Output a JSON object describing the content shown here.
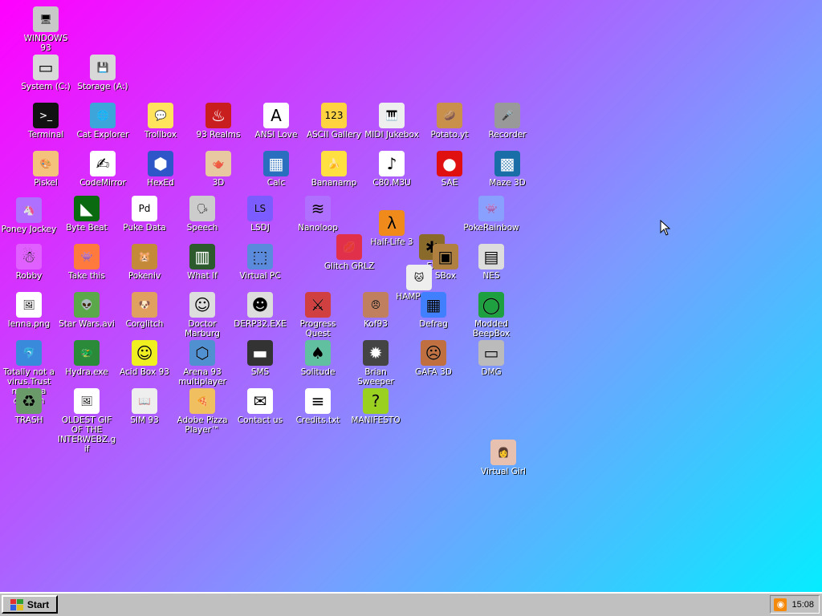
{
  "desktop": {
    "icons": [
      {
        "id": "windows93",
        "label": "WINDOWS 93",
        "icon": "computer-icon",
        "glyph": "🖥",
        "bg": "#c8c8c8"
      },
      {
        "id": "system-c",
        "label": "System (C:)",
        "icon": "hard-drive-icon",
        "glyph": "▭",
        "bg": "#d8d8d8"
      },
      {
        "id": "storage-a",
        "label": "Storage (A:)",
        "icon": "floppy-drive-icon",
        "glyph": "💾",
        "bg": "#d8d8d8"
      },
      {
        "id": "terminal",
        "label": "Terminal",
        "icon": "terminal-icon",
        "glyph": ">_",
        "bg": "#111111"
      },
      {
        "id": "cat-explorer",
        "label": "Cat Explorer",
        "icon": "cat-globe-icon",
        "glyph": "🌐",
        "bg": "#3da5d9"
      },
      {
        "id": "trollbox",
        "label": "Trollbox",
        "icon": "chat-bubble-icon",
        "glyph": "💬",
        "bg": "#ffe35c"
      },
      {
        "id": "93-realms",
        "label": "93 Realms",
        "icon": "realms-icon",
        "glyph": "♨",
        "bg": "#c81e1e"
      },
      {
        "id": "ansi-love",
        "label": "ANSI Love",
        "icon": "ansi-letter-icon",
        "glyph": "A",
        "bg": "#ffffff"
      },
      {
        "id": "ascii-gallery",
        "label": "ASCII Gallery",
        "icon": "ascii-numbers-icon",
        "glyph": "123",
        "bg": "#ffd23f"
      },
      {
        "id": "midi-jukebox",
        "label": "MIDI Jukebox",
        "icon": "piano-icon",
        "glyph": "🎹",
        "bg": "#eeeeee"
      },
      {
        "id": "potato-yt",
        "label": "Potato.yt",
        "icon": "potato-icon",
        "glyph": "🥔",
        "bg": "#c8904a"
      },
      {
        "id": "recorder",
        "label": "Recorder",
        "icon": "microphone-icon",
        "glyph": "🎤",
        "bg": "#999999"
      },
      {
        "id": "piskel",
        "label": "Piskel",
        "icon": "palette-icon",
        "glyph": "🎨",
        "bg": "#f4c27a"
      },
      {
        "id": "codemirror",
        "label": "CodeMirror",
        "icon": "codemirror-icon",
        "glyph": "✍",
        "bg": "#ffffff"
      },
      {
        "id": "hexed",
        "label": "HexEd",
        "icon": "hex-cube-icon",
        "glyph": "⬢",
        "bg": "#2e56c8"
      },
      {
        "id": "3d",
        "label": "3D",
        "icon": "teapot-icon",
        "glyph": "🫖",
        "bg": "#e8c8a0"
      },
      {
        "id": "calc",
        "label": "Calc",
        "icon": "calculator-icon",
        "glyph": "▦",
        "bg": "#2a6fbf"
      },
      {
        "id": "bananamp",
        "label": "Bananamp",
        "icon": "banana-icon",
        "glyph": "🍌",
        "bg": "#ffe040"
      },
      {
        "id": "c80-m3u",
        "label": "C80.M3U",
        "icon": "playlist-file-icon",
        "glyph": "♪",
        "bg": "#ffffff"
      },
      {
        "id": "sae",
        "label": "SAE",
        "icon": "checkered-ball-icon",
        "glyph": "●",
        "bg": "#e01010"
      },
      {
        "id": "maze-3d",
        "label": "Maze 3D",
        "icon": "maze-icon",
        "glyph": "▩",
        "bg": "#1a6ea8"
      },
      {
        "id": "poney-jockey",
        "label": "Poney Jockey",
        "icon": "pony-icon",
        "glyph": "🦄",
        "bg": "#b070ff"
      },
      {
        "id": "byte-beat",
        "label": "Byte Beat",
        "icon": "bytebeat-icon",
        "glyph": "◣",
        "bg": "#0a6a10"
      },
      {
        "id": "puke-data",
        "label": "Puke Data",
        "icon": "pd-icon",
        "glyph": "Pd",
        "bg": "#ffffff"
      },
      {
        "id": "speech",
        "label": "Speech",
        "icon": "speech-face-icon",
        "glyph": "🗣",
        "bg": "#cccccc"
      },
      {
        "id": "lsdj",
        "label": "LSDJ",
        "icon": "lsdj-icon",
        "glyph": "LS",
        "bg": "#7a5cff"
      },
      {
        "id": "nanoloop",
        "label": "Nanoloop",
        "icon": "nanoloop-icon",
        "glyph": "≋",
        "bg": "#b070ff"
      },
      {
        "id": "half-life-3",
        "label": "Half-Life 3",
        "icon": "lambda-icon",
        "glyph": "λ",
        "bg": "#f08a1a"
      },
      {
        "id": "pokerainbow",
        "label": "PokeRainbow",
        "icon": "pokerainbow-icon",
        "glyph": "👾",
        "bg": "#8aa0ff"
      },
      {
        "id": "glitch-grlz",
        "label": "Glitch GRLZ",
        "icon": "lips-icon",
        "glyph": "💋",
        "bg": "#e0304a"
      },
      {
        "id": "robby",
        "label": "Robby",
        "icon": "stick-figure-icon",
        "glyph": "☃",
        "bg": "#e060ff"
      },
      {
        "id": "take-this",
        "label": "Take this",
        "icon": "take-this-icon",
        "glyph": "👾",
        "bg": "#ff7a3c"
      },
      {
        "id": "pokeniv",
        "label": "Pokeniv",
        "icon": "pokeniv-icon",
        "glyph": "🐹",
        "bg": "#c48a3a"
      },
      {
        "id": "what-if",
        "label": "What If",
        "icon": "what-if-icon",
        "glyph": "▥",
        "bg": "#2c5a2c"
      },
      {
        "id": "virtual-pc",
        "label": "Virtual PC",
        "icon": "window-cursor-icon",
        "glyph": "⬚",
        "bg": "#5a8adc"
      },
      {
        "id": "fx",
        "label": "FX",
        "icon": "fx-star-icon",
        "glyph": "✱",
        "bg": "#8a6a2a"
      },
      {
        "id": "hampster",
        "label": "HAMPSTER",
        "icon": "hamster-icon",
        "glyph": "🐱",
        "bg": "#eeeeee"
      },
      {
        "id": "sbox",
        "label": "SBox",
        "icon": "sbox-icon",
        "glyph": "▣",
        "bg": "#b08040"
      },
      {
        "id": "nes",
        "label": "NES",
        "icon": "nes-icon",
        "glyph": "▤",
        "bg": "#dddddd"
      },
      {
        "id": "lenna-png",
        "label": "lenna.png",
        "icon": "image-file-icon",
        "glyph": "🖼",
        "bg": "#ffffff"
      },
      {
        "id": "star-wars-avi",
        "label": "Star Wars.avi",
        "icon": "yoda-icon",
        "glyph": "👽",
        "bg": "#5aa84a"
      },
      {
        "id": "corglitch",
        "label": "Corglitch",
        "icon": "corgi-icon",
        "glyph": "🐶",
        "bg": "#e0a060"
      },
      {
        "id": "doctor-marburg",
        "label": "Doctor Marburg",
        "icon": "doctor-icon",
        "glyph": "☺",
        "bg": "#dddddd"
      },
      {
        "id": "derp32-exe",
        "label": "DERP32.EXE",
        "icon": "derp-monitor-icon",
        "glyph": "☻",
        "bg": "#dddddd"
      },
      {
        "id": "progress-quest",
        "label": "Progress Quest",
        "icon": "crossed-swords-icon",
        "glyph": "⚔",
        "bg": "#d04040"
      },
      {
        "id": "kof93",
        "label": "Kof93",
        "icon": "fighter-portrait-icon",
        "glyph": "😠",
        "bg": "#c08060"
      },
      {
        "id": "defrag",
        "label": "Defrag",
        "icon": "defrag-icon",
        "glyph": "▦",
        "bg": "#4080ff"
      },
      {
        "id": "modded-beepbox",
        "label": "Modded BeepBox",
        "icon": "green-ring-icon",
        "glyph": "◯",
        "bg": "#1ea040"
      },
      {
        "id": "totally-not-a-virus",
        "label": "Totally not a virus.Trust me im a dolphin",
        "icon": "dolphin-icon",
        "glyph": "🐬",
        "bg": "#3a8adc"
      },
      {
        "id": "hydra-exe",
        "label": "Hydra.exe",
        "icon": "hydra-icon",
        "glyph": "🐲",
        "bg": "#2a8a3a"
      },
      {
        "id": "acid-box-93",
        "label": "Acid Box 93",
        "icon": "smiley-icon",
        "glyph": "☺",
        "bg": "#f0f020"
      },
      {
        "id": "arena-93",
        "label": "Arena 93 multiplayer",
        "icon": "cube-icon",
        "glyph": "⬡",
        "bg": "#5090d0"
      },
      {
        "id": "sms",
        "label": "SMS",
        "icon": "console-icon",
        "glyph": "▬",
        "bg": "#333333"
      },
      {
        "id": "solitude",
        "label": "Solitude",
        "icon": "solitude-icon",
        "glyph": "♠",
        "bg": "#60c0a0"
      },
      {
        "id": "brian-sweeper",
        "label": "Brian Sweeper",
        "icon": "mine-icon",
        "glyph": "✹",
        "bg": "#444444"
      },
      {
        "id": "gafa-3d",
        "label": "GAFA 3D",
        "icon": "doom-face-icon",
        "glyph": "☹",
        "bg": "#c07040"
      },
      {
        "id": "dmg",
        "label": "DMG",
        "icon": "gameboy-cartridge-icon",
        "glyph": "▭",
        "bg": "#bbbbbb"
      },
      {
        "id": "trash",
        "label": "TRASH",
        "icon": "recycle-bin-icon",
        "glyph": "♻",
        "bg": "#6a9a6a"
      },
      {
        "id": "oldest-gif",
        "label": "OLDEST GIF OF THE INTERWEBZ.gif",
        "icon": "gif-file-icon",
        "glyph": "🖼",
        "bg": "#ffffff"
      },
      {
        "id": "sim-93",
        "label": "SIM 93",
        "icon": "sim-book-icon",
        "glyph": "📖",
        "bg": "#eeeeee"
      },
      {
        "id": "adobe-pizza",
        "label": "Adobe Pizza Player™",
        "icon": "pizza-icon",
        "glyph": "🍕",
        "bg": "#f0c060"
      },
      {
        "id": "contact-us",
        "label": "Contact us",
        "icon": "mail-pen-icon",
        "glyph": "✉",
        "bg": "#ffffff"
      },
      {
        "id": "credits-txt",
        "label": "Credits.txt",
        "icon": "text-file-icon",
        "glyph": "≡",
        "bg": "#ffffff"
      },
      {
        "id": "manifesto",
        "label": "MANIFESTO",
        "icon": "question-mark-icon",
        "glyph": "?",
        "bg": "#9ad020"
      },
      {
        "id": "virtual-girl",
        "label": "Virtual Girl",
        "icon": "girl-portrait-icon",
        "glyph": "👩",
        "bg": "#e8c0b0"
      }
    ]
  },
  "taskbar": {
    "start_label": "Start",
    "clock": "15:08",
    "tray_icon": "rss-icon"
  },
  "colors": {
    "gradient_start": "#ff00ff",
    "gradient_end": "#00f0ff",
    "taskbar": "#c0c0c0",
    "icon_label": "#ffffff"
  }
}
